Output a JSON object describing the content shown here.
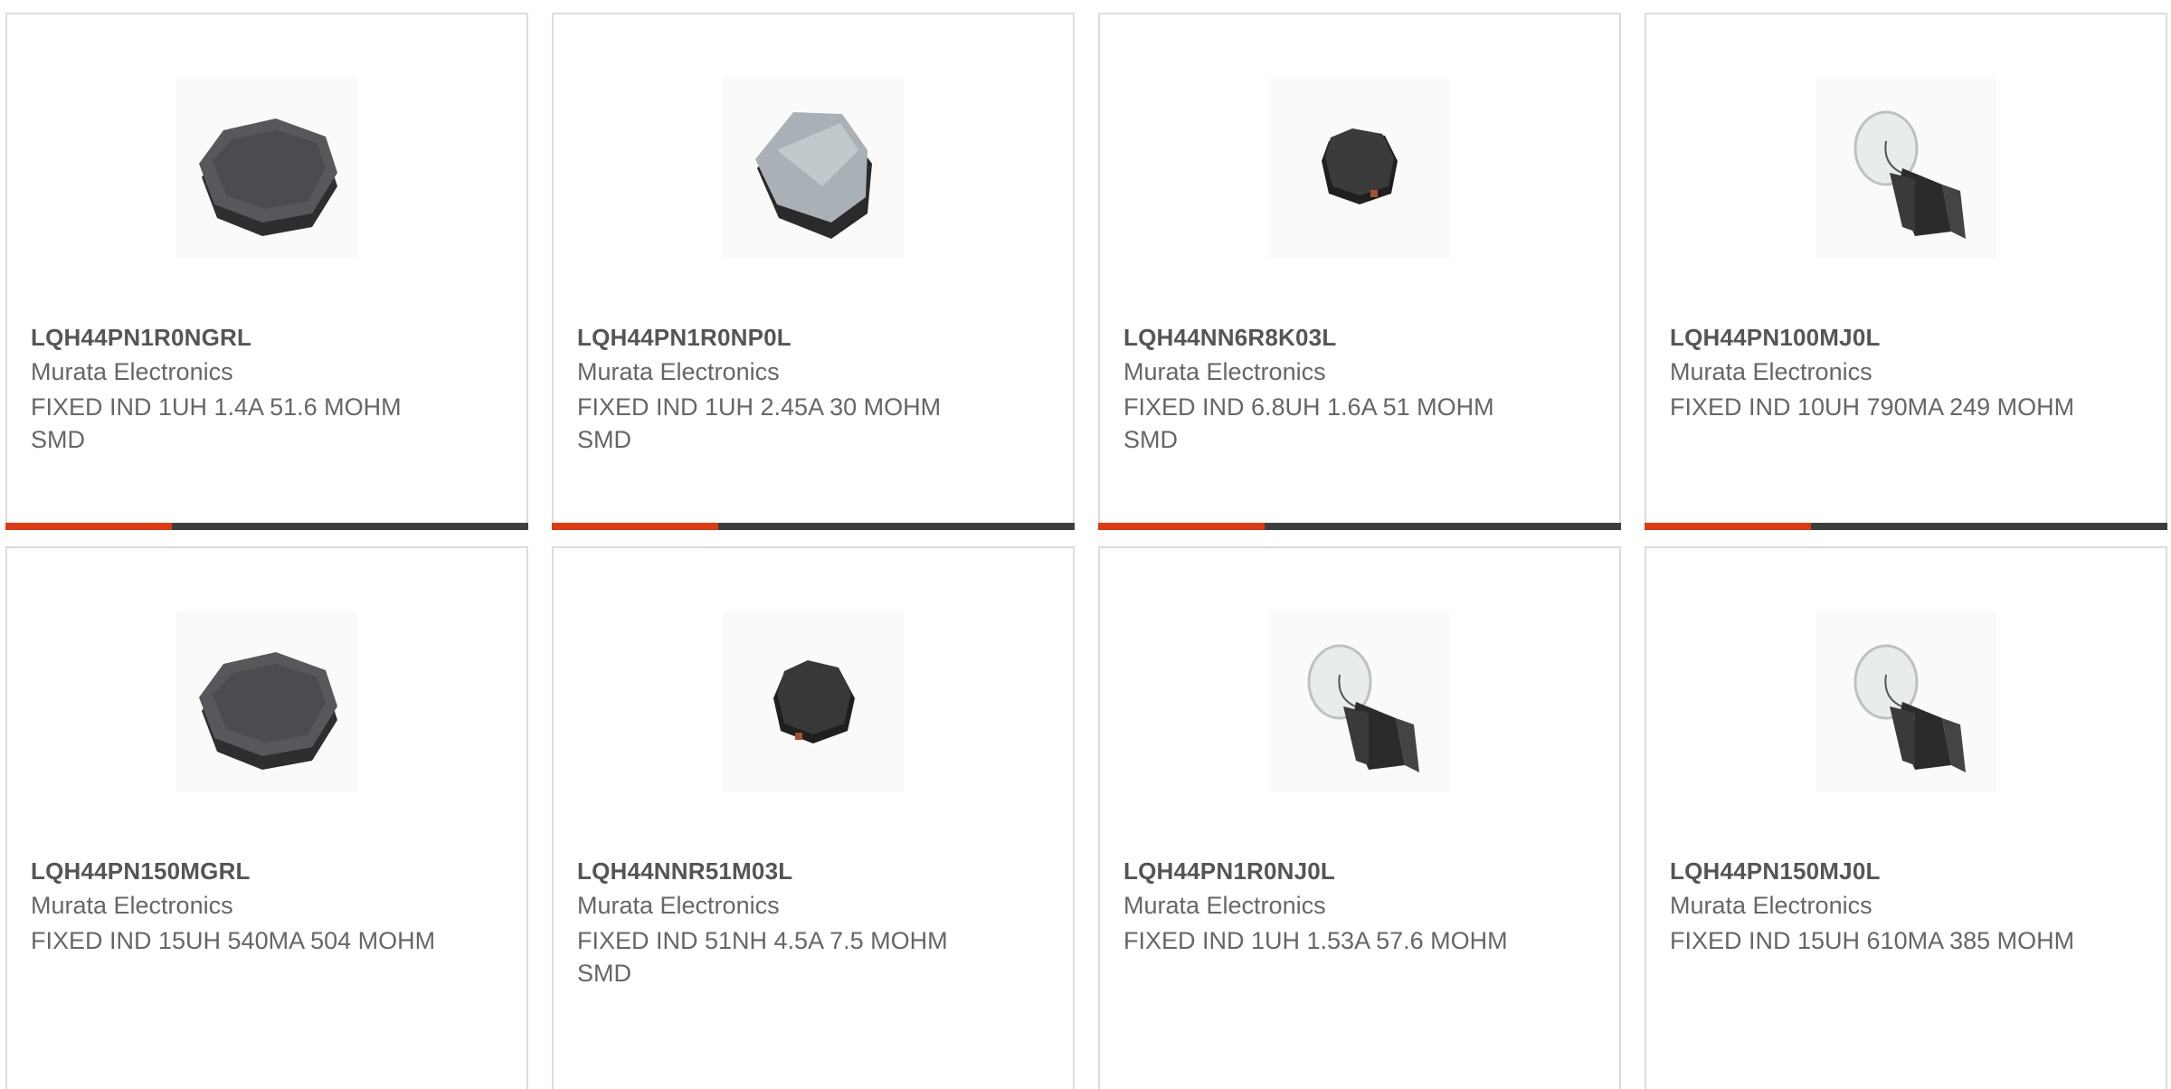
{
  "products": [
    {
      "part_number": "LQH44PN1R0NGRL",
      "manufacturer": "Murata Electronics",
      "description": "FIXED IND 1UH 1.4A 51.6 MOHM SMD",
      "image": "inductor-large-icon"
    },
    {
      "part_number": "LQH44PN1R0NP0L",
      "manufacturer": "Murata Electronics",
      "description": "FIXED IND 1UH 2.45A 30 MOHM SMD",
      "image": "inductor-silver-icon"
    },
    {
      "part_number": "LQH44NN6R8K03L",
      "manufacturer": "Murata Electronics",
      "description": "FIXED IND 6.8UH 1.6A 51 MOHM SMD",
      "image": "inductor-small-icon"
    },
    {
      "part_number": "LQH44PN100MJ0L",
      "manufacturer": "Murata Electronics",
      "description": "FIXED IND 10UH 790MA 249 MOHM",
      "image": "bulb-icon"
    },
    {
      "part_number": "LQH44PN150MGRL",
      "manufacturer": "Murata Electronics",
      "description": "FIXED IND 15UH 540MA 504 MOHM",
      "image": "inductor-large-icon"
    },
    {
      "part_number": "LQH44NNR51M03L",
      "manufacturer": "Murata Electronics",
      "description": "FIXED IND 51NH 4.5A 7.5 MOHM SMD",
      "image": "inductor-small-icon"
    },
    {
      "part_number": "LQH44PN1R0NJ0L",
      "manufacturer": "Murata Electronics",
      "description": "FIXED IND 1UH 1.53A 57.6 MOHM",
      "image": "bulb-icon"
    },
    {
      "part_number": "LQH44PN150MJ0L",
      "manufacturer": "Murata Electronics",
      "description": "FIXED IND 15UH 610MA 385 MOHM",
      "image": "bulb-icon"
    }
  ],
  "colors": {
    "accent": "#e03a10",
    "bar": "#3d3d3d",
    "text": "#666666",
    "border": "#dcdcdc"
  }
}
